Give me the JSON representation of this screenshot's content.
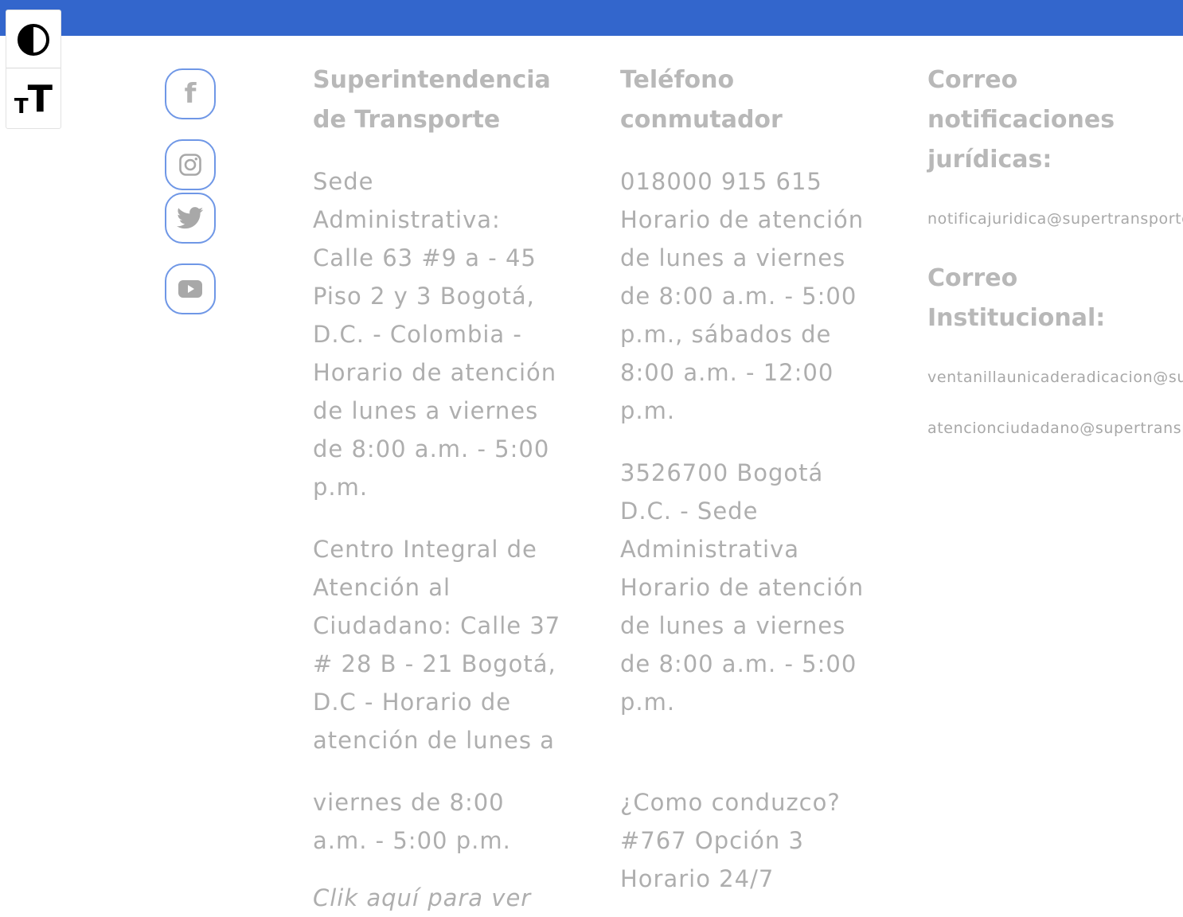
{
  "accessibility": {
    "contrast_icon": "contrast-icon",
    "text_size_icon": "text-size-icon",
    "text_size_glyph_small": "T",
    "text_size_glyph_big": "T"
  },
  "social": [
    {
      "name": "facebook",
      "icon": "facebook-icon",
      "glyph": "f"
    },
    {
      "name": "instagram",
      "icon": "instagram-icon"
    },
    {
      "name": "twitter",
      "icon": "twitter-icon"
    },
    {
      "name": "youtube",
      "icon": "youtube-icon"
    }
  ],
  "columns": {
    "entity": {
      "title_line1": "Superintendencia",
      "title_line2": "de Transporte",
      "sede_lines": [
        "Sede",
        "Administrativa:",
        "Calle 63 #9 a - 45",
        "Piso 2 y 3 Bogotá,",
        "D.C. - Colombia -",
        "Horario de atención",
        "de lunes a viernes",
        "de 8:00 a.m. - 5:00",
        "p.m."
      ],
      "centro_lines": [
        "Centro Integral de",
        "Atención al",
        "Ciudadano: Calle 37",
        "# 28 B - 21 Bogotá,",
        "D.C - Horario de",
        "atención de lunes a"
      ],
      "centro_cont_lines": [
        "viernes de 8:00",
        "a.m. - 5:00 p.m."
      ],
      "link_text": "Clik aquí para ver"
    },
    "phone": {
      "title_line1": "Teléfono",
      "title_line2": "conmutador",
      "block1_lines": [
        "018000 915 615",
        "Horario de atención",
        "de lunes a viernes",
        "de 8:00 a.m. - 5:00",
        "p.m., sábados de",
        "8:00 a.m. - 12:00",
        "p.m."
      ],
      "block2_lines": [
        "3526700 Bogotá",
        "D.C. - Sede",
        "Administrativa",
        "Horario de atención",
        "de lunes a viernes",
        "de 8:00 a.m. - 5:00",
        "p.m."
      ],
      "block3_lines": [
        "¿Como conduzco?",
        "#767 Opción 3",
        "Horario 24/7"
      ]
    },
    "mail": {
      "notif_title_lines": [
        "Correo",
        "notificaciones",
        "jurídicas:"
      ],
      "notif_email": "notificajuridica@supertransporte.gov.co",
      "inst_title_lines": [
        "Correo",
        "Institucional:"
      ],
      "inst_email_1": "ventanillaunicaderadicacion@supertransporte.gov.co",
      "inst_email_2": "atencionciudadano@supertransporte.gov.co"
    }
  },
  "colors": {
    "top_bar": "#3366cc",
    "social_border": "#6f97e6",
    "text_gray": "#aeaeae",
    "heading_gray": "#b8b8b8"
  }
}
